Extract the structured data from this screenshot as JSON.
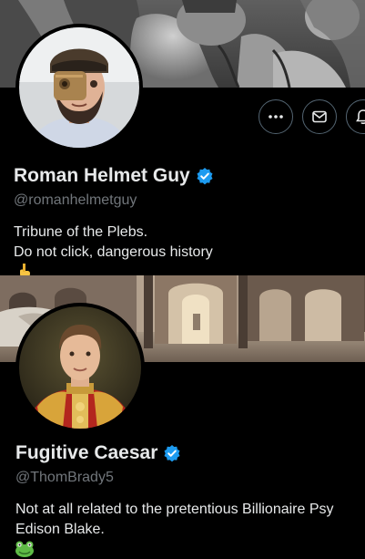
{
  "colors": {
    "background": "#000000",
    "text_primary": "#e7e9ea",
    "text_secondary": "#71767b",
    "verified_badge": "#1d9bf0",
    "button_border": "#536471"
  },
  "profiles": [
    {
      "name": "Roman Helmet Guy",
      "handle": "@romanhelmetguy",
      "bio_lines": [
        "Tribune of the Plebs.",
        "Do not click, dangerous history"
      ],
      "bio_emoji": "pointing-down-hand-icon",
      "verified": true,
      "banner": "roman-statues-relief",
      "actions": [
        {
          "icon": "more-icon"
        },
        {
          "icon": "message-icon"
        },
        {
          "icon": "notification-bell-icon"
        }
      ]
    },
    {
      "name": "Fugitive Caesar",
      "handle": "@ThomBrady5",
      "bio_lines": [
        "Not at all related to the pretentious Billionaire Psy",
        "Edison Blake."
      ],
      "bio_emoji": "frog-icon",
      "verified": true,
      "banner": "palace-corridor-painting"
    }
  ]
}
